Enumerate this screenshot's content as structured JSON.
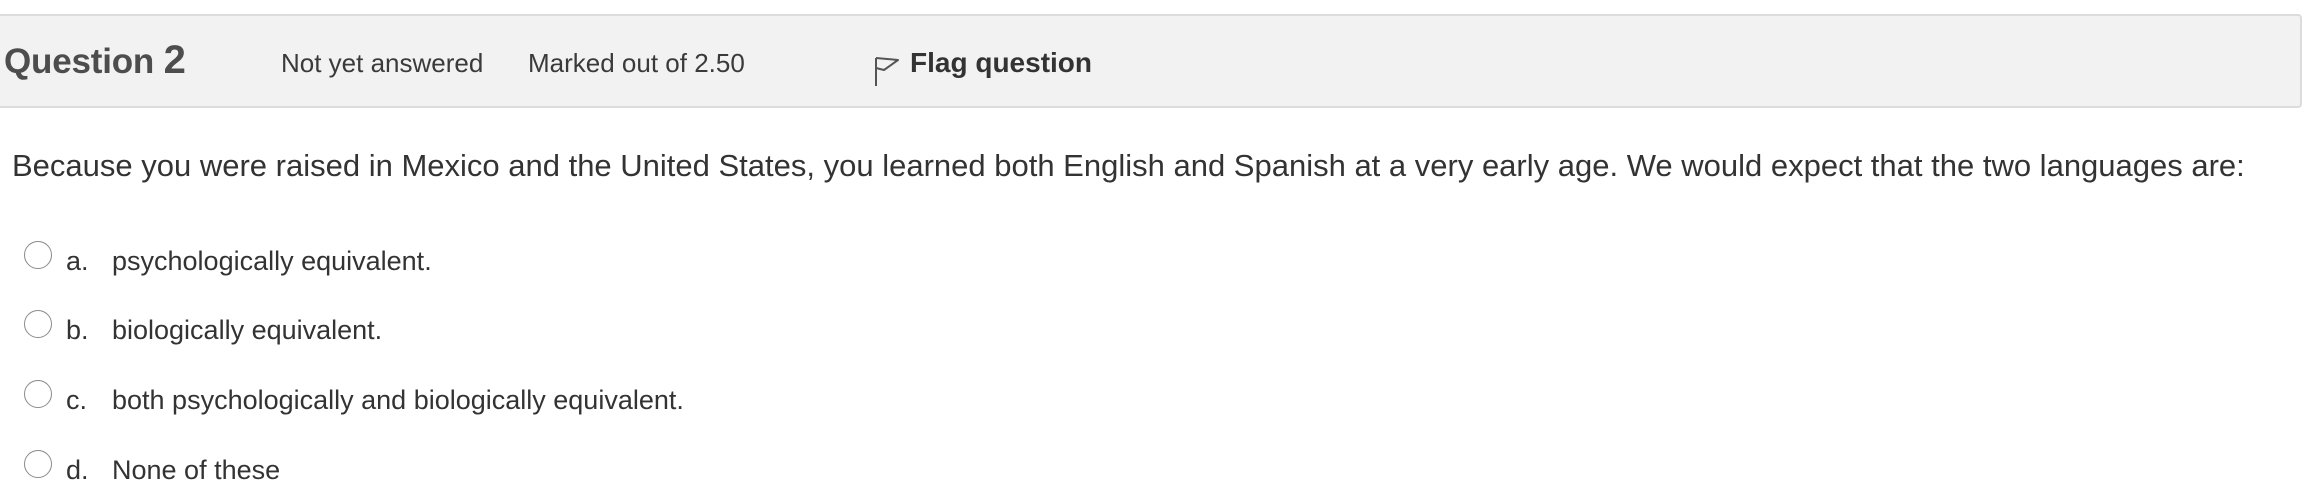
{
  "question": {
    "title_prefix": "Question",
    "number": "2",
    "state": "Not yet answered",
    "grade": "Marked out of 2.50",
    "flag_label": "Flag question",
    "flag_icon": "flag-icon",
    "text": "Because you were raised in Mexico and the United States, you learned both English and Spanish at a very early age. We would expect that the two languages are:"
  },
  "answers": [
    {
      "letter": "a.",
      "text": "psychologically equivalent.",
      "selected": false
    },
    {
      "letter": "b.",
      "text": "biologically equivalent.",
      "selected": false
    },
    {
      "letter": "c.",
      "text": "both psychologically and biologically equivalent.",
      "selected": false
    },
    {
      "letter": "d.",
      "text": "None of these",
      "selected": false
    }
  ],
  "colors": {
    "info_background": "#f2f2f2",
    "info_border": "#dcdcdc",
    "text": "#333333"
  }
}
